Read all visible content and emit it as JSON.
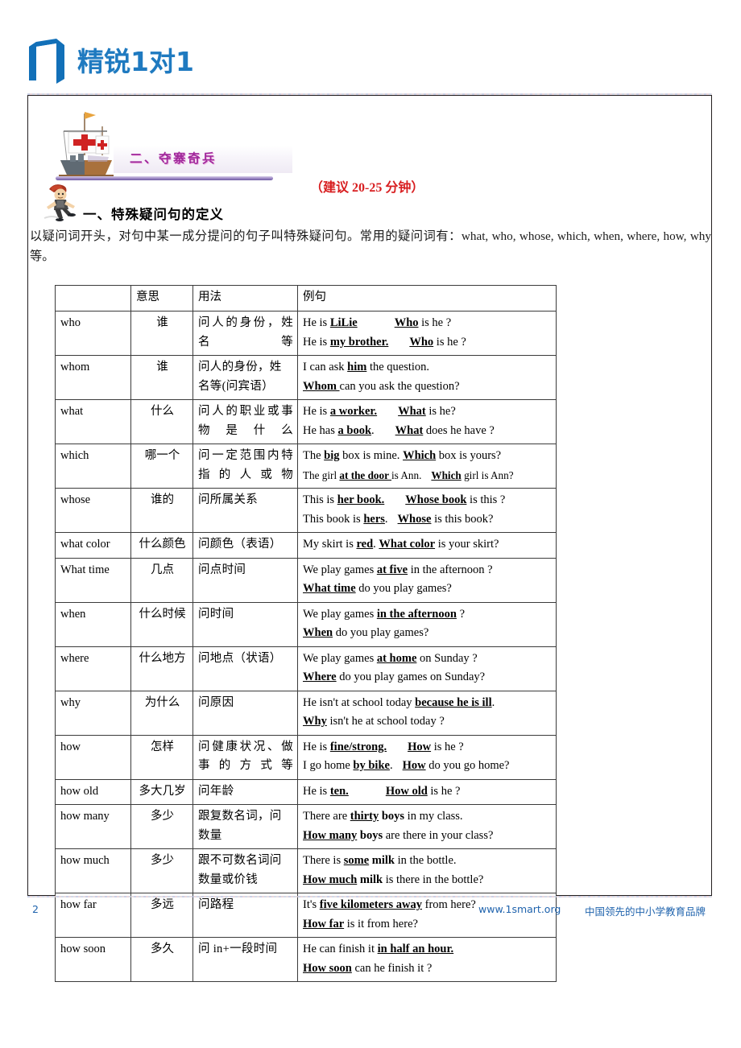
{
  "brand": {
    "title": "精锐1对1",
    "logo_color": "#1270b8",
    "title_color": "#1f7ac0"
  },
  "section": {
    "banner_title": "二、夺寨奇兵",
    "banner_title_color": "#a0289b",
    "time_note": "（建议 20-25 分钟）",
    "time_note_color": "#d81e20",
    "ship_icon": "sailing-ship-icon",
    "boy_icon": "running-boy-icon"
  },
  "lesson": {
    "heading": "一、特殊疑问句的定义",
    "intro": "以疑问词开头，对句中某一成分提问的句子叫特殊疑问句。常用的疑问词有：what, who, whose, which, when, where, how, why 等。"
  },
  "table": {
    "headers": [
      "",
      "意思",
      "用法",
      "例句"
    ],
    "rows": [
      {
        "word": "who",
        "meaning": "谁",
        "usage": "问人的身份，姓名等",
        "usage_justify": true,
        "examples": [
          {
            "parts": [
              {
                "t": "He is ",
                "b": false
              },
              {
                "t": "LiLie",
                "b": true
              },
              {
                "t": "GAPLG",
                "b": false
              },
              {
                "t": "Who",
                "b": true
              },
              {
                "t": " is he ?",
                "b": false
              }
            ]
          },
          {
            "parts": [
              {
                "t": "He is ",
                "b": false
              },
              {
                "t": "my brother.",
                "b": true
              },
              {
                "t": "GAPMD",
                "b": false
              },
              {
                "t": "Who",
                "b": true
              },
              {
                "t": " is he ?",
                "b": false
              }
            ]
          }
        ]
      },
      {
        "word": "whom",
        "meaning": "谁",
        "usage": "问人的身份，姓名等(问宾语）",
        "usage_justify": false,
        "examples": [
          {
            "parts": [
              {
                "t": "I can ask ",
                "b": false
              },
              {
                "t": "him",
                "b": true
              },
              {
                "t": " the question.",
                "b": false
              }
            ]
          },
          {
            "parts": [
              {
                "t": "Whom  ",
                "b": true
              },
              {
                "t": " can you ask the question?",
                "b": false
              }
            ]
          }
        ]
      },
      {
        "word": "what",
        "meaning": "什么",
        "usage": "问人的职业或事物是什么",
        "usage_justify": true,
        "examples": [
          {
            "parts": [
              {
                "t": "He is ",
                "b": false
              },
              {
                "t": "a worker.",
                "b": true
              },
              {
                "t": "GAPMD",
                "b": false
              },
              {
                "t": "What",
                "b": true
              },
              {
                "t": " is he?",
                "b": false
              }
            ]
          },
          {
            "parts": [
              {
                "t": "He has ",
                "b": false
              },
              {
                "t": "a book",
                "b": true
              },
              {
                "t": ".",
                "b": false
              },
              {
                "t": "GAPMD",
                "b": false
              },
              {
                "t": "What",
                "b": true
              },
              {
                "t": " does he have ?",
                "b": false
              }
            ]
          }
        ]
      },
      {
        "word": "which",
        "meaning": "哪一个",
        "usage": "问一定范围内特指的人或物",
        "usage_justify": true,
        "examples": [
          {
            "parts": [
              {
                "t": "The ",
                "b": false
              },
              {
                "t": "big",
                "b": true
              },
              {
                "t": " box is mine. ",
                "b": false
              },
              {
                "t": "Which",
                "b": true
              },
              {
                "t": " box is yours?",
                "b": false
              }
            ]
          },
          {
            "small": true,
            "parts": [
              {
                "t": "The girl ",
                "b": false
              },
              {
                "t": "at the door ",
                "b": true
              },
              {
                "t": "is Ann.",
                "b": false
              },
              {
                "t": "GAP",
                "b": false
              },
              {
                "t": "Which",
                "b": true
              },
              {
                "t": " girl is Ann?",
                "b": false
              }
            ]
          }
        ]
      },
      {
        "word": "whose",
        "meaning": "谁的",
        "usage": "问所属关系",
        "usage_justify": false,
        "examples": [
          {
            "parts": [
              {
                "t": "This is ",
                "b": false
              },
              {
                "t": "her book.",
                "b": true
              },
              {
                "t": "GAPMD",
                "b": false
              },
              {
                "t": "Whose book",
                "b": true
              },
              {
                "t": " is this ?",
                "b": false
              }
            ]
          },
          {
            "parts": [
              {
                "t": "This book is ",
                "b": false
              },
              {
                "t": "hers",
                "b": true
              },
              {
                "t": ".",
                "b": false
              },
              {
                "t": "GAP",
                "b": false
              },
              {
                "t": "Whose",
                "b": true
              },
              {
                "t": " is this book?",
                "b": false
              }
            ]
          }
        ]
      },
      {
        "word": "what color",
        "meaning": "什么颜色",
        "usage": "问颜色（表语）",
        "usage_justify": false,
        "examples": [
          {
            "parts": [
              {
                "t": "My skirt is ",
                "b": false
              },
              {
                "t": "red",
                "b": true
              },
              {
                "t": ". ",
                "b": false
              },
              {
                "t": "What color",
                "b": true
              },
              {
                "t": " is your skirt?",
                "b": false
              }
            ]
          }
        ]
      },
      {
        "word": "What time",
        "meaning": "几点",
        "usage": "问点时间",
        "usage_justify": false,
        "examples": [
          {
            "parts": [
              {
                "t": "We play games ",
                "b": false
              },
              {
                "t": "at five",
                "b": true
              },
              {
                "t": " in the afternoon ?",
                "b": false
              }
            ]
          },
          {
            "parts": [
              {
                "t": "What time",
                "b": true
              },
              {
                "t": " do you play games?",
                "b": false
              }
            ]
          }
        ]
      },
      {
        "word": "when",
        "meaning": "什么时候",
        "usage": "问时间",
        "usage_justify": false,
        "examples": [
          {
            "parts": [
              {
                "t": "We play games ",
                "b": false
              },
              {
                "t": "in the afternoon",
                "b": true
              },
              {
                "t": " ?",
                "b": false
              }
            ]
          },
          {
            "parts": [
              {
                "t": "When",
                "b": true
              },
              {
                "t": " do you play games?",
                "b": false
              }
            ]
          }
        ]
      },
      {
        "word": "where",
        "meaning": "什么地方",
        "usage": "问地点（状语）",
        "usage_justify": false,
        "examples": [
          {
            "parts": [
              {
                "t": "We play games ",
                "b": false
              },
              {
                "t": "at home",
                "b": true
              },
              {
                "t": " on Sunday ?",
                "b": false
              }
            ]
          },
          {
            "parts": [
              {
                "t": "Where",
                "b": true
              },
              {
                "t": " do you play games on Sunday?",
                "b": false
              }
            ]
          }
        ]
      },
      {
        "word": "why",
        "meaning": "为什么",
        "usage": "问原因",
        "usage_justify": false,
        "examples": [
          {
            "parts": [
              {
                "t": "He isn't at school today ",
                "b": false
              },
              {
                "t": "because he is ill",
                "b": true
              },
              {
                "t": ".",
                "b": false
              }
            ]
          },
          {
            "parts": [
              {
                "t": "Why",
                "b": true
              },
              {
                "t": " isn't he at school today ?",
                "b": false
              }
            ]
          }
        ]
      },
      {
        "word": "how",
        "meaning": "怎样",
        "usage": "问健康状况、做事的方式等",
        "usage_justify": true,
        "examples": [
          {
            "parts": [
              {
                "t": "He is ",
                "b": false
              },
              {
                "t": "fine/strong.",
                "b": true
              },
              {
                "t": "GAPMD",
                "b": false
              },
              {
                "t": "How",
                "b": true
              },
              {
                "t": " is he ?",
                "b": false
              }
            ]
          },
          {
            "parts": [
              {
                "t": "I go home ",
                "b": false
              },
              {
                "t": "by bike",
                "b": true
              },
              {
                "t": ".",
                "b": false
              },
              {
                "t": "GAP",
                "b": false
              },
              {
                "t": "How",
                "b": true
              },
              {
                "t": " do you go home?",
                "b": false
              }
            ]
          }
        ]
      },
      {
        "word": "how old",
        "meaning": "多大几岁",
        "usage": "问年龄",
        "usage_justify": false,
        "examples": [
          {
            "parts": [
              {
                "t": "He is ",
                "b": false
              },
              {
                "t": "ten.",
                "b": true
              },
              {
                "t": "GAPLG",
                "b": false
              },
              {
                "t": "How old",
                "b": true
              },
              {
                "t": " is he ?",
                "b": false
              }
            ]
          }
        ]
      },
      {
        "word": "how many",
        "meaning": "多少",
        "usage": "跟复数名词，问数量",
        "usage_justify": false,
        "examples": [
          {
            "parts": [
              {
                "t": "There are ",
                "b": false
              },
              {
                "t": "thirty",
                "b": true
              },
              {
                "t": " boys",
                "b": true,
                "nounder": true
              },
              {
                "t": " in my class.",
                "b": false
              }
            ]
          },
          {
            "parts": [
              {
                "t": "How many",
                "b": true
              },
              {
                "t": " boys",
                "b": true,
                "nounder": true
              },
              {
                "t": " are there in your class?",
                "b": false
              }
            ]
          }
        ]
      },
      {
        "word": "how much",
        "meaning": "多少",
        "usage": "跟不可数名词问数量或价钱",
        "usage_justify": false,
        "examples": [
          {
            "parts": [
              {
                "t": "There is ",
                "b": false
              },
              {
                "t": "some",
                "b": true
              },
              {
                "t": " milk",
                "b": true,
                "nounder": true
              },
              {
                "t": " in the bottle.",
                "b": false
              }
            ]
          },
          {
            "parts": [
              {
                "t": "How much",
                "b": true
              },
              {
                "t": " milk",
                "b": true,
                "nounder": true
              },
              {
                "t": " is there in the bottle?",
                "b": false
              }
            ]
          }
        ]
      },
      {
        "word": "how far",
        "meaning": "多远",
        "usage": "问路程",
        "usage_justify": false,
        "examples": [
          {
            "parts": [
              {
                "t": "It's ",
                "b": false
              },
              {
                "t": "five kilometers away",
                "b": true
              },
              {
                "t": " from here?",
                "b": false
              }
            ]
          },
          {
            "parts": [
              {
                "t": "How far",
                "b": true
              },
              {
                "t": " is it from here?",
                "b": false
              }
            ]
          }
        ]
      },
      {
        "word": "how soon",
        "meaning": "多久",
        "usage": "问 in+一段时间",
        "usage_justify": false,
        "examples": [
          {
            "parts": [
              {
                "t": "He can finish it ",
                "b": false
              },
              {
                "t": "in half an hour.",
                "b": true
              }
            ]
          },
          {
            "parts": [
              {
                "t": "How soon",
                "b": true
              },
              {
                "t": " can he finish it ?",
                "b": false
              }
            ]
          }
        ]
      }
    ]
  },
  "footer": {
    "page_number": "2",
    "site": "www.1smart.org",
    "slogan": "中国领先的中小学教育品牌",
    "color": "#1f63ad"
  }
}
